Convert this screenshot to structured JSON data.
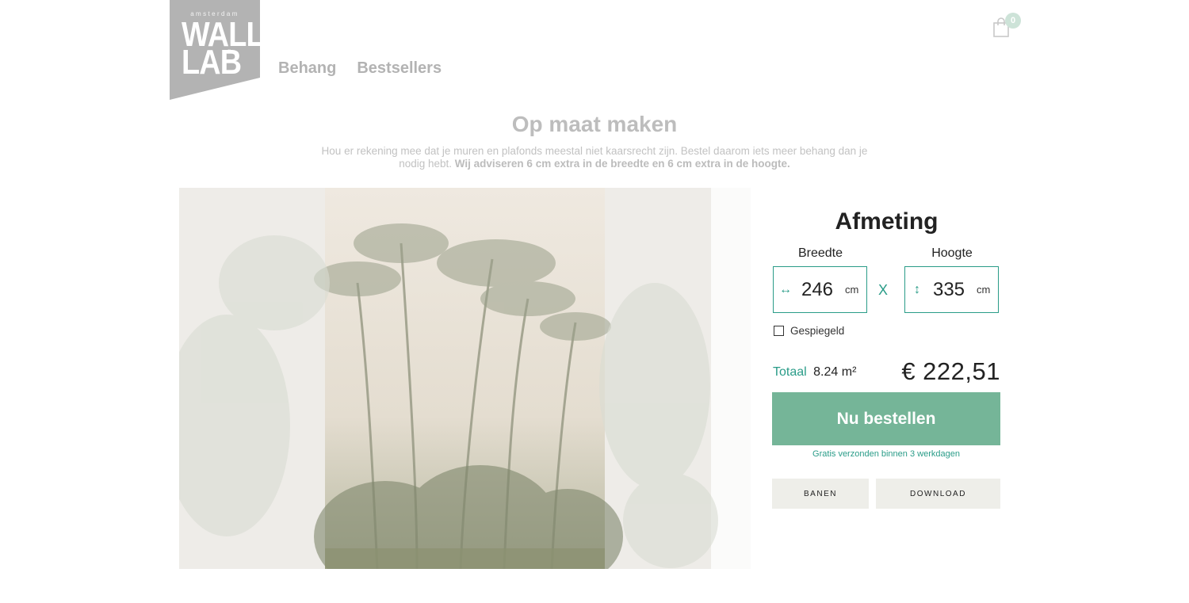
{
  "logo": {
    "top": "amsterdam",
    "line1": "WALL",
    "line2": "LAB",
    "reg": "®"
  },
  "nav": {
    "items": [
      "Behang",
      "Bestsellers"
    ]
  },
  "cart": {
    "count": "0"
  },
  "header": {
    "title": "Op maat maken",
    "intro": "Hou er rekening mee dat je muren en plafonds meestal niet kaarsrecht zijn. Bestel daarom iets meer behang dan je nodig hebt.",
    "intro_bold": "Wij adviseren 6 cm extra in de breedte en 6 cm extra in de hoogte."
  },
  "config": {
    "title": "Afmeting",
    "width_label": "Breedte",
    "height_label": "Hoogte",
    "width_value": "246",
    "height_value": "335",
    "unit": "cm",
    "times": "X",
    "mirror_label": "Gespiegeld",
    "mirror_checked": false,
    "total_label": "Totaal",
    "total_area": "8.24 m²",
    "price": "€ 222,51",
    "order_button": "Nu bestellen",
    "shipping_note": "Gratis verzonden binnen 3 werkdagen",
    "banen_button": "BANEN",
    "download_button": "DOWNLOAD"
  },
  "icons": {
    "width": "horizontal-arrows-icon",
    "height": "vertical-arrows-icon",
    "cart": "shopping-bag-icon"
  },
  "colors": {
    "accent": "#2a9c88",
    "button": "#75b598",
    "logo": "#b3b3b3",
    "secondary_button": "#eeeee9"
  }
}
